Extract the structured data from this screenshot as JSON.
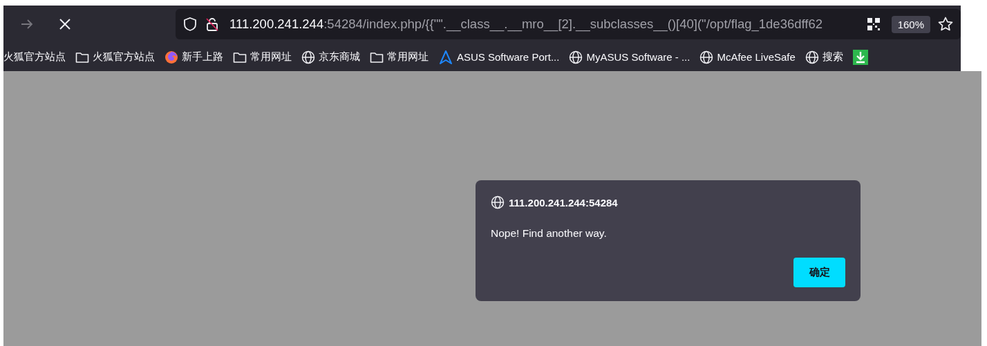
{
  "toolbar": {
    "forward": {
      "disabled": true
    },
    "url": {
      "host": "111.200.241.244",
      "rest": ":54284/index.php/{{\"\".__class__.__mro__[2].__subclasses__()[40](\"/opt/flag_1de36dff62"
    },
    "zoom": "160%"
  },
  "bookmarks": [
    {
      "kind": "plain",
      "label": "火狐官方站点"
    },
    {
      "kind": "folder",
      "label": "火狐官方站点"
    },
    {
      "kind": "firefox",
      "label": "新手上路"
    },
    {
      "kind": "folder",
      "label": "常用网址"
    },
    {
      "kind": "globe",
      "label": "京东商城"
    },
    {
      "kind": "folder",
      "label": "常用网址"
    },
    {
      "kind": "asus",
      "label": "ASUS Software Port..."
    },
    {
      "kind": "globe",
      "label": "MyASUS Software - ..."
    },
    {
      "kind": "globe",
      "label": "McAfee LiveSafe"
    },
    {
      "kind": "globe",
      "label": "搜索"
    },
    {
      "kind": "download"
    }
  ],
  "dialog": {
    "origin": "111.200.241.244:54284",
    "message": "Nope! Find another way.",
    "button": "确定"
  }
}
